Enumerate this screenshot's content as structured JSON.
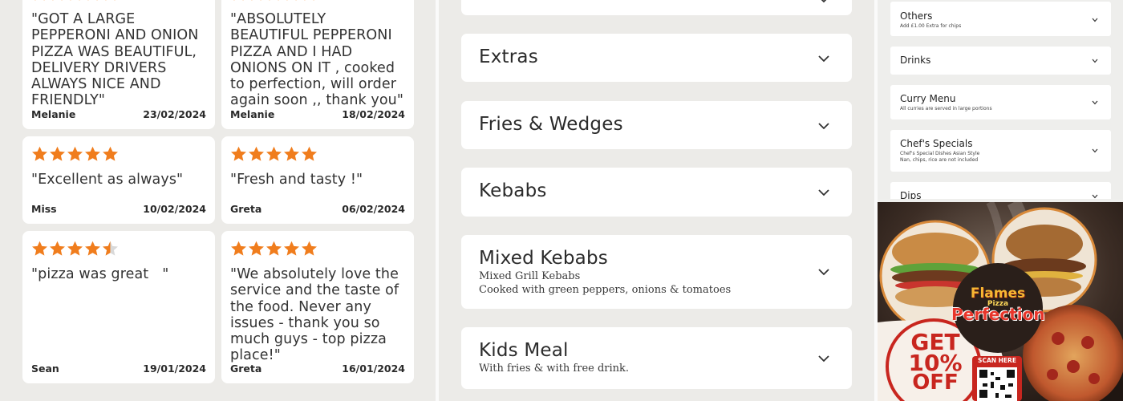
{
  "reviews": [
    {
      "quote": "\"GOT A LARGE PEPPERONI AND ONION PIZZA WAS BEAUTIFUL, DELIVERY DRIVERS ALWAYS NICE AND FRIENDLY\"",
      "author": "Melanie",
      "date": "23/02/2024",
      "rating": 5
    },
    {
      "quote": "\"ABSOLUTELY BEAUTIFUL PEPPERONI PIZZA AND I HAD ONIONS ON IT , cooked to perfection, will order again soon ,, thank you\"",
      "author": "Melanie",
      "date": "18/02/2024",
      "rating": 5
    },
    {
      "quote": "\"Excellent as always\"",
      "author": "Miss",
      "date": "10/02/2024",
      "rating": 5
    },
    {
      "quote": "\"Fresh and tasty !\"",
      "author": "Greta",
      "date": "06/02/2024",
      "rating": 5
    },
    {
      "quote": "\"pizza was great   \"",
      "author": "Sean",
      "date": "19/01/2024",
      "rating": 4.5
    },
    {
      "quote": "\"We absolutely love the service and the taste of the food. Never any issues - thank you so much guys - top pizza place!\"",
      "author": "Greta",
      "date": "16/01/2024",
      "rating": 5
    }
  ],
  "menu": {
    "categories": [
      {
        "title": "",
        "subtitle": ""
      },
      {
        "title": "Extras",
        "subtitle": ""
      },
      {
        "title": "Fries & Wedges",
        "subtitle": ""
      },
      {
        "title": "Kebabs",
        "subtitle": ""
      },
      {
        "title": "Mixed Kebabs",
        "subtitle": "Mixed Grill Kebabs\nCooked with green peppers, onions & tomatoes"
      },
      {
        "title": "Kids Meal",
        "subtitle": "With fries & with free drink."
      }
    ]
  },
  "side_menu": {
    "items": [
      {
        "title": "Others",
        "subtitle": "Add £1.00 Extra for chips"
      },
      {
        "title": "Drinks",
        "subtitle": ""
      },
      {
        "title": "Curry Menu",
        "subtitle": "All curries are served in large portions"
      },
      {
        "title": "Chef's Specials",
        "subtitle": "Chef's Special Dishes Asian Style\nNan, chips, rice are not included"
      },
      {
        "title": "Dips",
        "subtitle": ""
      }
    ]
  },
  "promo": {
    "logo_top": "Flames",
    "logo_mid": "Pizza",
    "logo_main": "Perfection",
    "offer_get": "GET",
    "offer_pct": "10%",
    "offer_off": "OFF",
    "scan": "SCAN HERE"
  },
  "colors": {
    "star": "#f07d1d",
    "star_empty": "#d9d9d9",
    "panel_bg": "#ecebe8",
    "card_bg": "#ffffff",
    "promo_red": "#c8261f"
  },
  "icons": {
    "star": "star-icon",
    "chevron": "chevron-down-icon",
    "qr": "qr-code-icon"
  }
}
